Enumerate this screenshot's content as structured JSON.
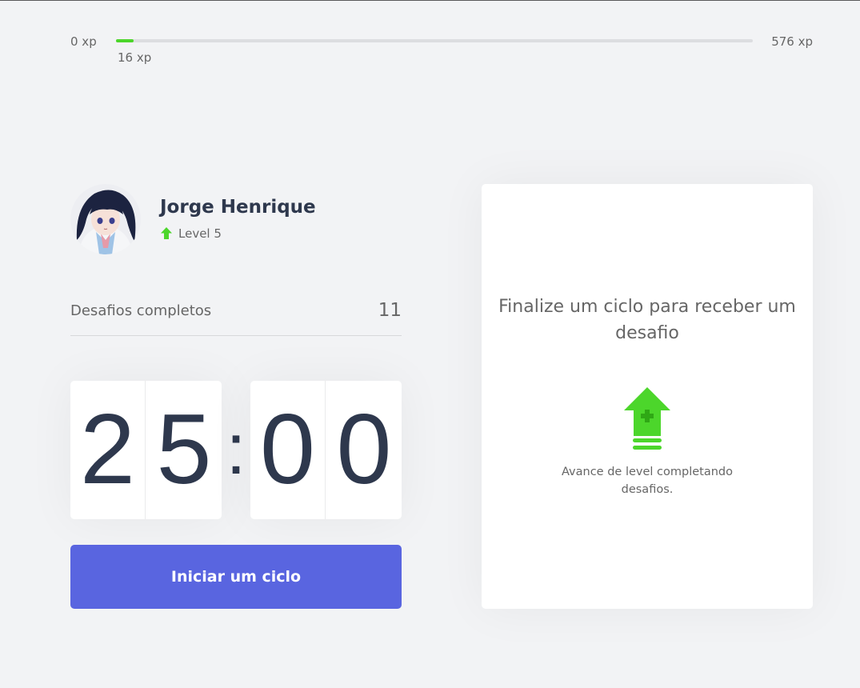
{
  "xp": {
    "min_label": "0 xp",
    "max_label": "576 xp",
    "current_label": "16 xp",
    "current_value": 16,
    "max_value": 576
  },
  "profile": {
    "name": "Jorge Henrique",
    "level_label": "Level 5",
    "avatar": "avatar-image",
    "level_icon": "level-up-arrow-icon"
  },
  "completed": {
    "label": "Desafios completos",
    "count": "11"
  },
  "countdown": {
    "minute_left": "2",
    "minute_right": "5",
    "separator": ":",
    "second_left": "0",
    "second_right": "0"
  },
  "actions": {
    "start_label": "Iniciar um ciclo"
  },
  "challenge": {
    "title": "Finalize um ciclo para receber um desafio",
    "hint": "Avance de level completando desafios.",
    "icon": "level-up-icon"
  },
  "colors": {
    "accent_green": "#4CD62B",
    "button_blue": "#5965E0",
    "title_dark": "#2E384D",
    "background": "#F2F3F5"
  }
}
